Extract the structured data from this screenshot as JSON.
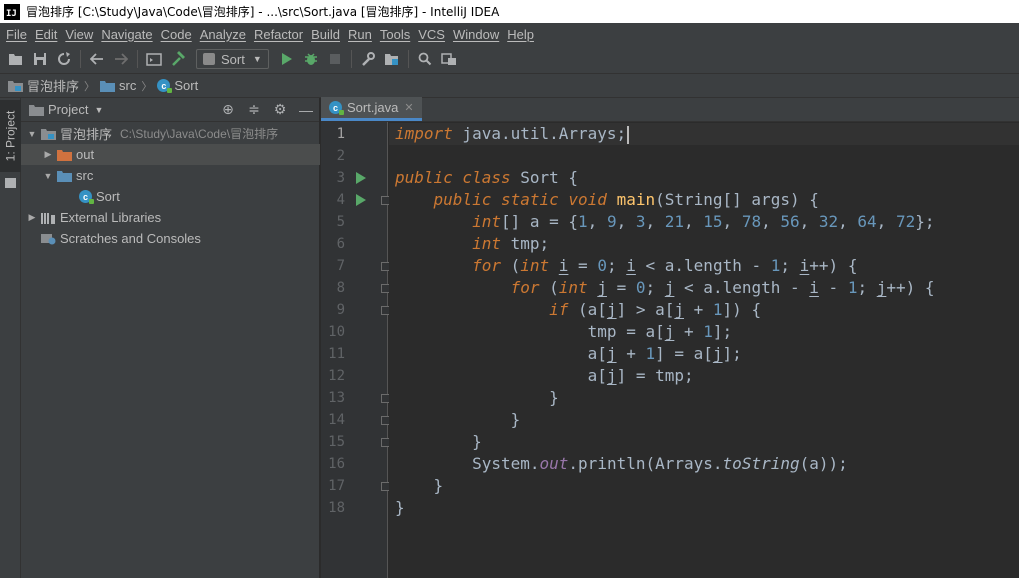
{
  "window": {
    "title": "冒泡排序 [C:\\Study\\Java\\Code\\冒泡排序] - ...\\src\\Sort.java [冒泡排序] - IntelliJ IDEA",
    "app_icon_text": "IJ"
  },
  "menu": [
    "File",
    "Edit",
    "View",
    "Navigate",
    "Code",
    "Analyze",
    "Refactor",
    "Build",
    "Run",
    "Tools",
    "VCS",
    "Window",
    "Help"
  ],
  "toolbar": {
    "run_config": "Sort"
  },
  "breadcrumb": [
    "冒泡排序",
    "src",
    "Sort"
  ],
  "stripe": {
    "project_tab": "1: Project"
  },
  "project_panel": {
    "title": "Project",
    "tree": [
      {
        "label": "冒泡排序",
        "path": "C:\\Study\\Java\\Code\\冒泡排序",
        "type": "module",
        "expanded": true
      },
      {
        "label": "out",
        "type": "folder-excluded",
        "expanded": false
      },
      {
        "label": "src",
        "type": "folder-source",
        "expanded": true
      },
      {
        "label": "Sort",
        "type": "class"
      },
      {
        "label": "External Libraries",
        "type": "libraries",
        "expanded": false
      },
      {
        "label": "Scratches and Consoles",
        "type": "scratches"
      }
    ]
  },
  "editor": {
    "tab": "Sort.java",
    "current_line": 1,
    "line_numbers": [
      "1",
      "2",
      "3",
      "4",
      "5",
      "6",
      "7",
      "8",
      "9",
      "10",
      "11",
      "12",
      "13",
      "14",
      "15",
      "16",
      "17",
      "18"
    ]
  },
  "colors": {
    "keyword": "#cc7832",
    "number": "#6897bb",
    "method": "#ffc66d",
    "field": "#9876aa",
    "text": "#a9b7c6",
    "run_icon": "#59a869",
    "accent": "#4a88c7"
  }
}
